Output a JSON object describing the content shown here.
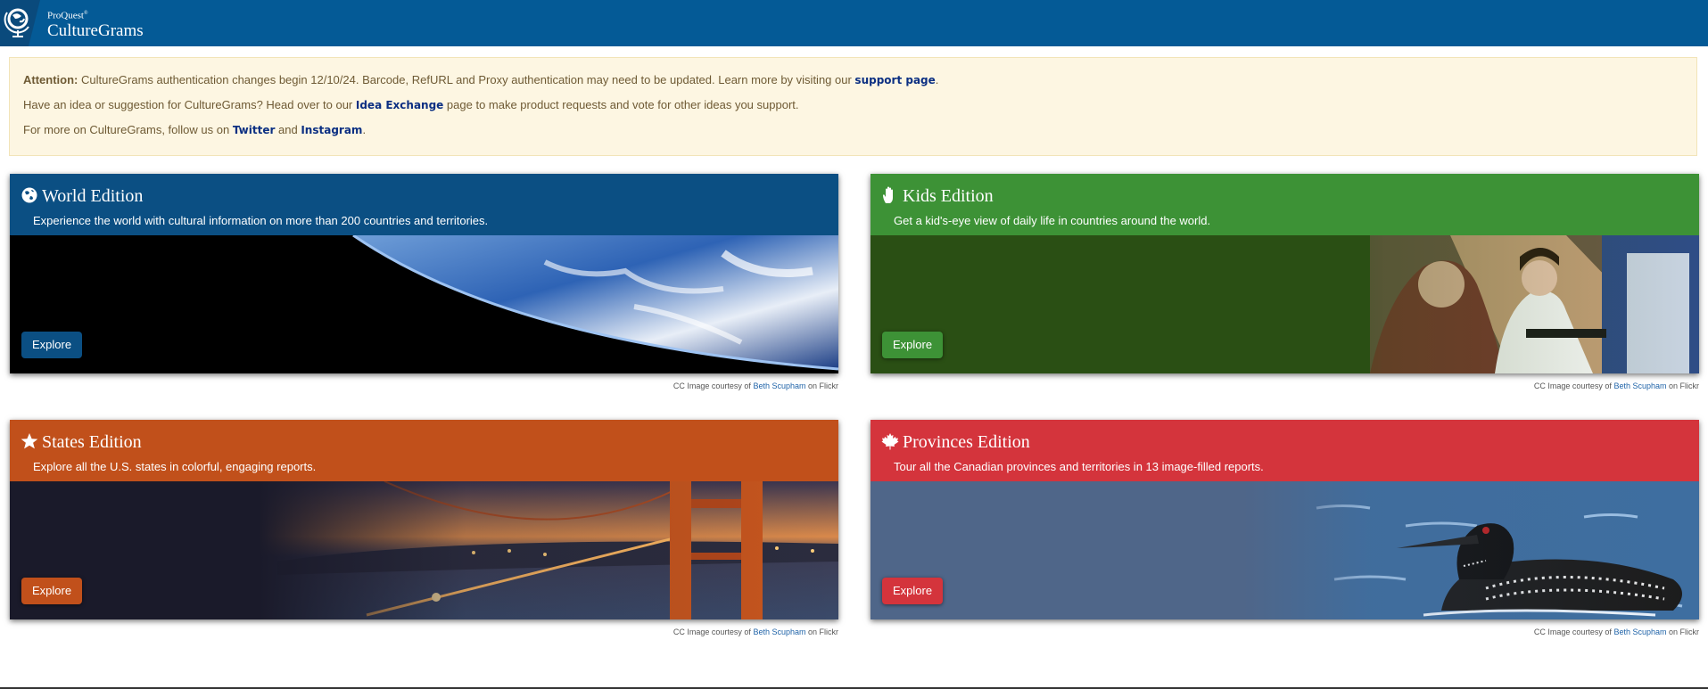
{
  "header": {
    "brand_small": "ProQuest",
    "brand_small_mark": "®",
    "brand_name": "CultureGrams",
    "logo_icon": "globe-icon"
  },
  "notice": {
    "line1": {
      "label": "Attention:",
      "text": " CultureGrams authentication changes begin 12/10/24. Barcode, RefURL and Proxy authentication may need to be updated. Learn more by visiting our ",
      "link": "support page",
      "end": "."
    },
    "line2": {
      "text": "Have an idea or suggestion for CultureGrams? Head over to our ",
      "link": "Idea Exchange",
      "end": " page to make product requests and vote for other ideas you support."
    },
    "line3": {
      "text": "For more on CultureGrams, follow us on ",
      "link1": "Twitter",
      "mid": " and ",
      "link2": "Instagram",
      "end": "."
    }
  },
  "editions": [
    {
      "title": "World Edition",
      "description": "Experience the world with cultural information on more than 200 countries and territories.",
      "button": "Explore",
      "icon": "globe-icon",
      "color": "#0b4f83"
    },
    {
      "title": "Kids Edition",
      "description": "Get a kid's-eye view of daily life in countries around the world.",
      "button": "Explore",
      "icon": "hand-icon",
      "color": "#3d9236"
    },
    {
      "title": "States Edition",
      "description": "Explore all the U.S. states in colorful, engaging reports.",
      "button": "Explore",
      "icon": "star-icon",
      "color": "#c1501b"
    },
    {
      "title": "Provinces Edition",
      "description": "Tour all the Canadian provinces and territories in 13 image-filled reports.",
      "button": "Explore",
      "icon": "maple-leaf-icon",
      "color": "#d4343c"
    }
  ],
  "credit": {
    "prefix": "CC Image courtesy of ",
    "author": "Beth Scupham",
    "suffix": " on Flickr"
  }
}
